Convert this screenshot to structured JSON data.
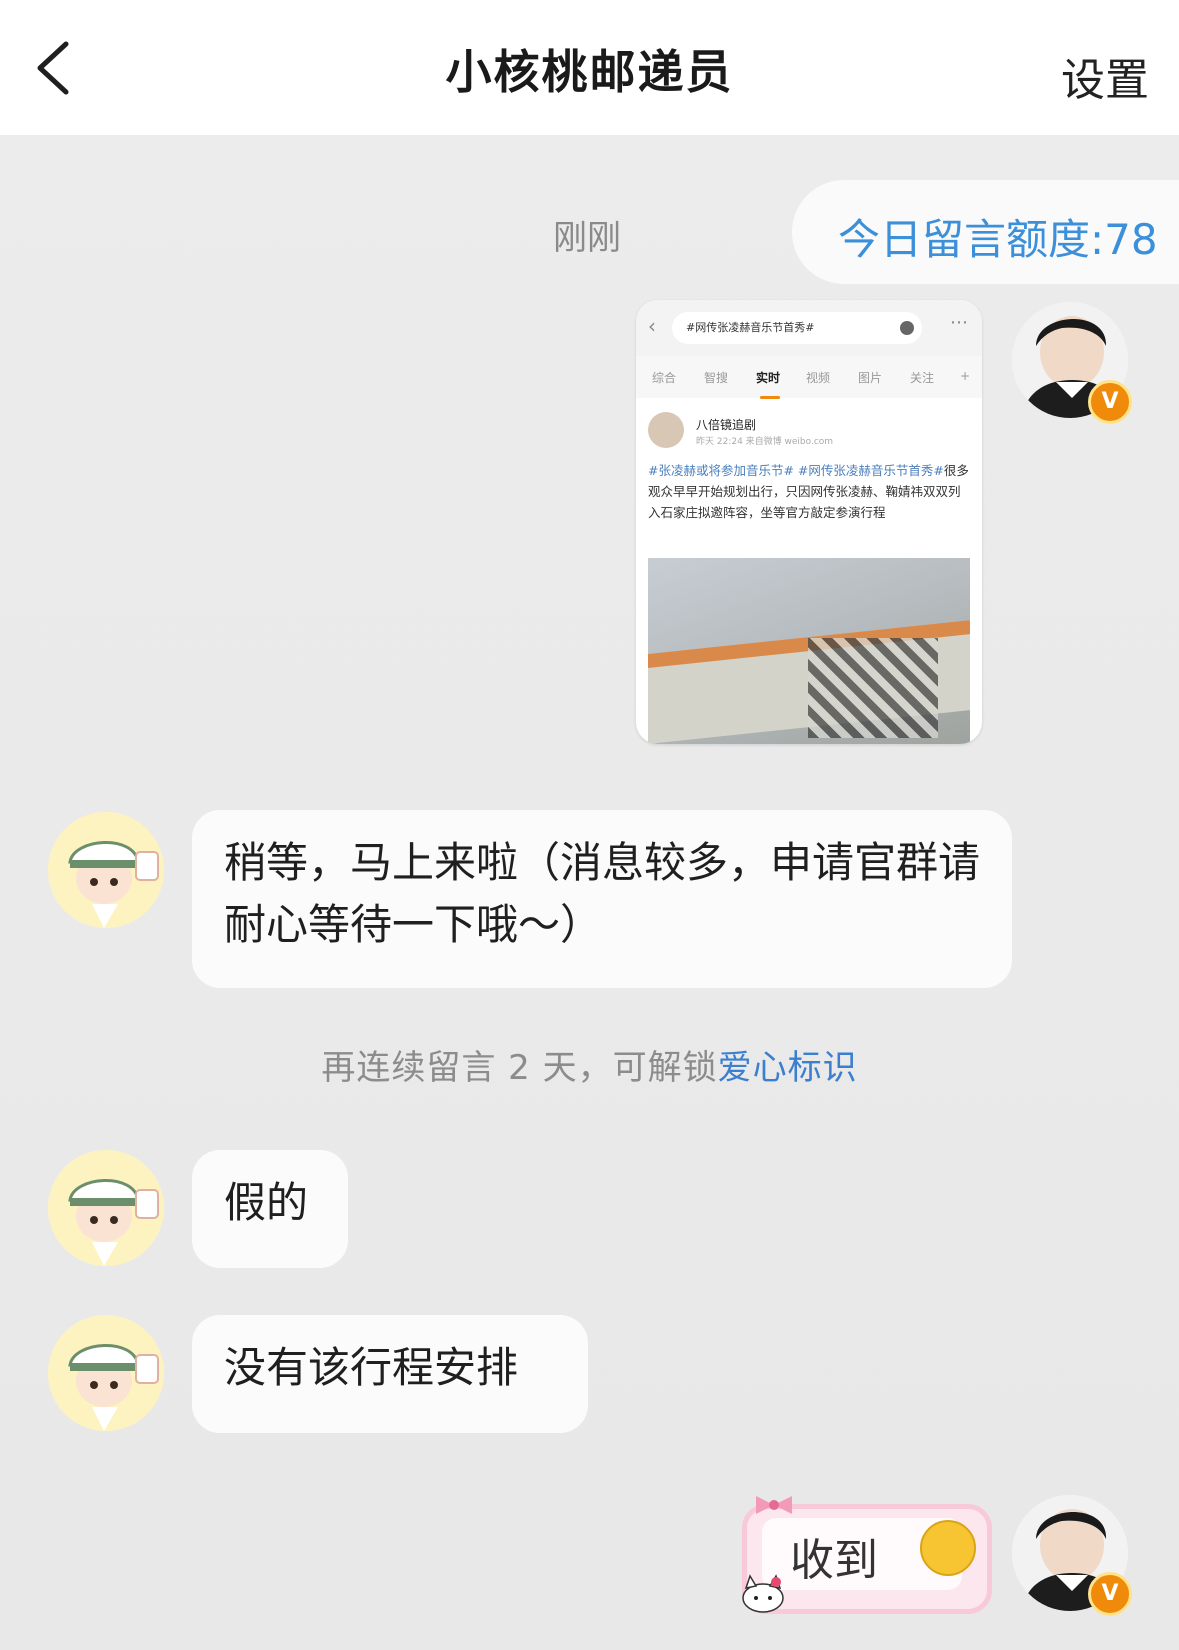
{
  "header": {
    "title": "小核桃邮递员",
    "settings_label": "设置"
  },
  "chat": {
    "time_label": "刚刚",
    "quota_text": "今日留言额度:78",
    "shared_screenshot": {
      "search_text": "#网传张凌赫音乐节首秀#",
      "tabs": [
        "综合",
        "智搜",
        "实时",
        "视频",
        "图片",
        "关注",
        "+"
      ],
      "active_tab": "实时",
      "poster_name": "八倍镜追剧",
      "post_meta": "昨天 22:24  来自微博 weibo.com",
      "post_tags": "#张凌赫或将参加音乐节# #网传张凌赫音乐节首秀#",
      "post_text": "很多观众早早开始规划出行，只因网传张凌赫、鞠婧祎双双列入石家庄拟邀阵容，坐等官方敲定参演行程"
    },
    "messages": [
      {
        "sender": "bot",
        "text": "稍等，马上来啦（消息较多，申请官群请耐心等待一下哦～）"
      },
      {
        "sender": "bot",
        "text": "假的"
      },
      {
        "sender": "bot",
        "text": "没有该行程安排"
      }
    ],
    "notice_prefix": "再连续留言 2 天，可解锁",
    "notice_link": "爱心标识",
    "sticker_text": "收到",
    "badge_letter": "V"
  },
  "colors": {
    "accent_blue": "#3c8fd9",
    "badge_orange": "#f08a0a"
  }
}
